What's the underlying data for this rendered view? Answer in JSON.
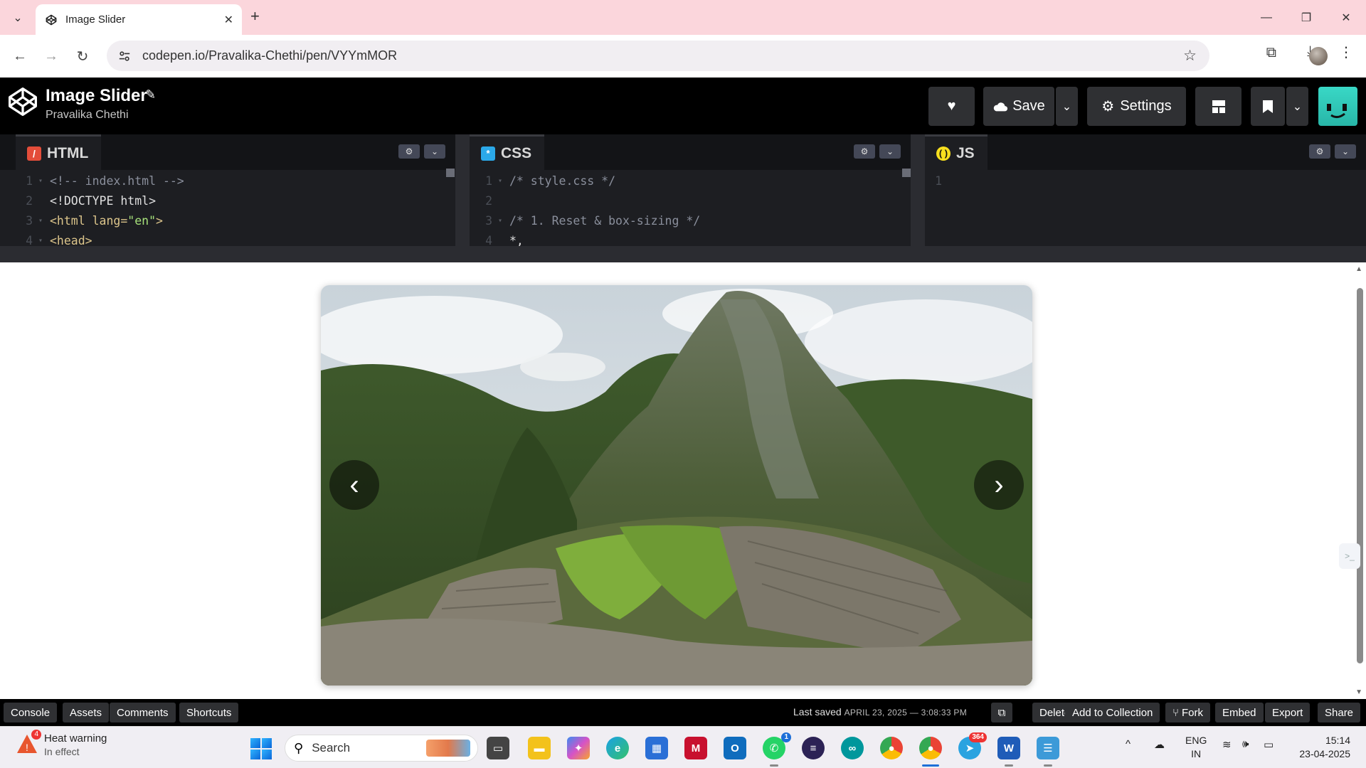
{
  "browser": {
    "tab_title": "Image Slider",
    "url": "codepen.io/Pravalika-Chethi/pen/VYYmMOR"
  },
  "codepen": {
    "pen_title": "Image Slider",
    "author": "Pravalika Chethi",
    "save_label": "Save",
    "settings_label": "Settings"
  },
  "editors": {
    "html": {
      "label": "HTML",
      "lines": [
        {
          "n": "1",
          "text": "<!-- index.html -->"
        },
        {
          "n": "2",
          "text": "<!DOCTYPE html>"
        },
        {
          "n": "3",
          "tag_open": "<html ",
          "attr": "lang=",
          "str": "\"en\"",
          "tag_close": ">"
        },
        {
          "n": "4",
          "text": "<head>"
        }
      ]
    },
    "css": {
      "label": "CSS",
      "lines": [
        {
          "n": "1",
          "text": "/* style.css */"
        },
        {
          "n": "2",
          "text": ""
        },
        {
          "n": "3",
          "text": "/* 1. Reset & box-sizing */"
        },
        {
          "n": "4",
          "text": "*,"
        }
      ]
    },
    "js": {
      "label": "JS",
      "lines": [
        {
          "n": "1",
          "text": ""
        }
      ]
    }
  },
  "slider": {
    "prev_label": "‹",
    "next_label": "›"
  },
  "footer": {
    "console": "Console",
    "assets": "Assets",
    "comments": "Comments",
    "shortcuts": "Shortcuts",
    "last_saved_label": "Last saved",
    "last_saved_date": "APRIL 23, 2025 — 3:08:33 PM",
    "delete": "Delete",
    "add_to_collection": "Add to Collection",
    "fork": "Fork",
    "embed": "Embed",
    "export": "Export",
    "share": "Share"
  },
  "taskbar": {
    "weather_title": "Heat warning",
    "weather_sub": "In effect",
    "weather_badge": "4",
    "search_label": "Search",
    "whatsapp_badge": "1",
    "telegram_badge": "364",
    "lang_top": "ENG",
    "lang_bottom": "IN",
    "time": "15:14",
    "date": "23-04-2025"
  }
}
